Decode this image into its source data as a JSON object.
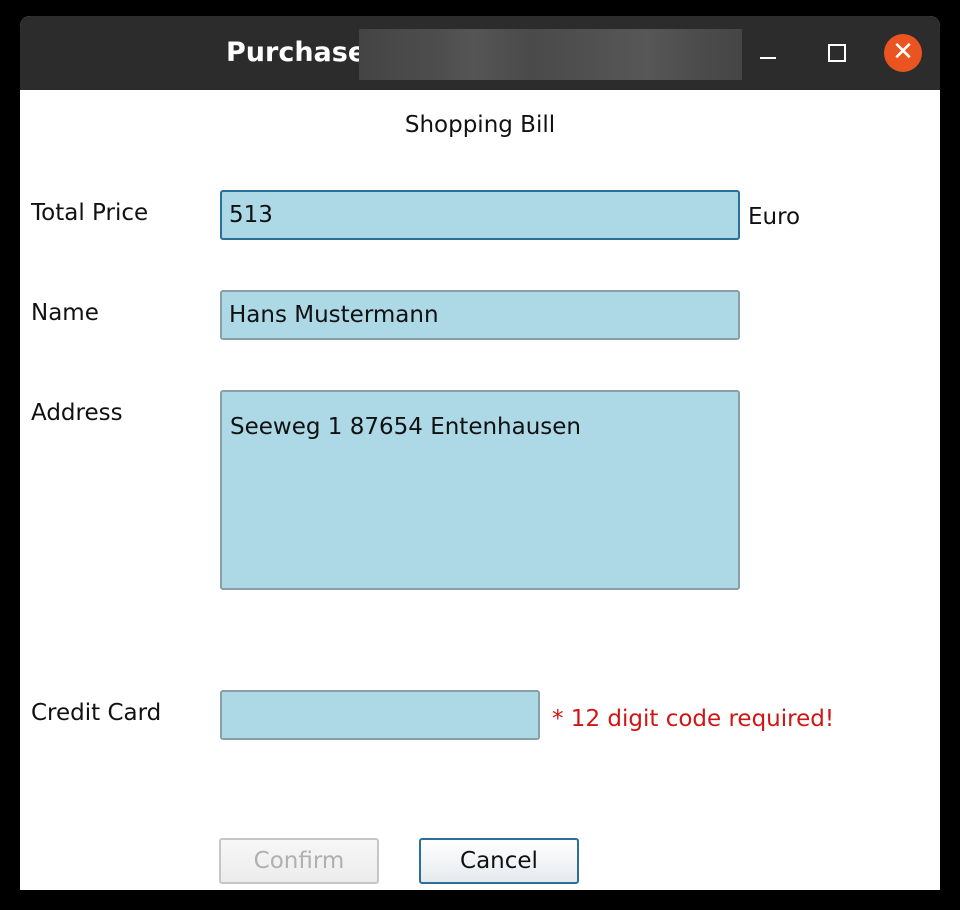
{
  "window": {
    "title": "Purchase",
    "close_glyph": "✕",
    "icons": [
      "minimize-icon",
      "maximize-icon",
      "close-icon"
    ],
    "close_color": "#e95420"
  },
  "form": {
    "heading": "Shopping Bill",
    "total_price": {
      "label": "Total Price",
      "value": "513",
      "suffix": "Euro"
    },
    "name": {
      "label": "Name",
      "value": "Hans Mustermann"
    },
    "address": {
      "label": "Address",
      "value": "Seeweg 1 87654 Entenhausen"
    },
    "credit_card": {
      "label": "Credit Card",
      "value": "",
      "error": "* 12 digit code required!"
    },
    "field_color": "#add8e6",
    "error_color": "#d11515"
  },
  "buttons": {
    "confirm": "Confirm",
    "cancel": "Cancel"
  }
}
